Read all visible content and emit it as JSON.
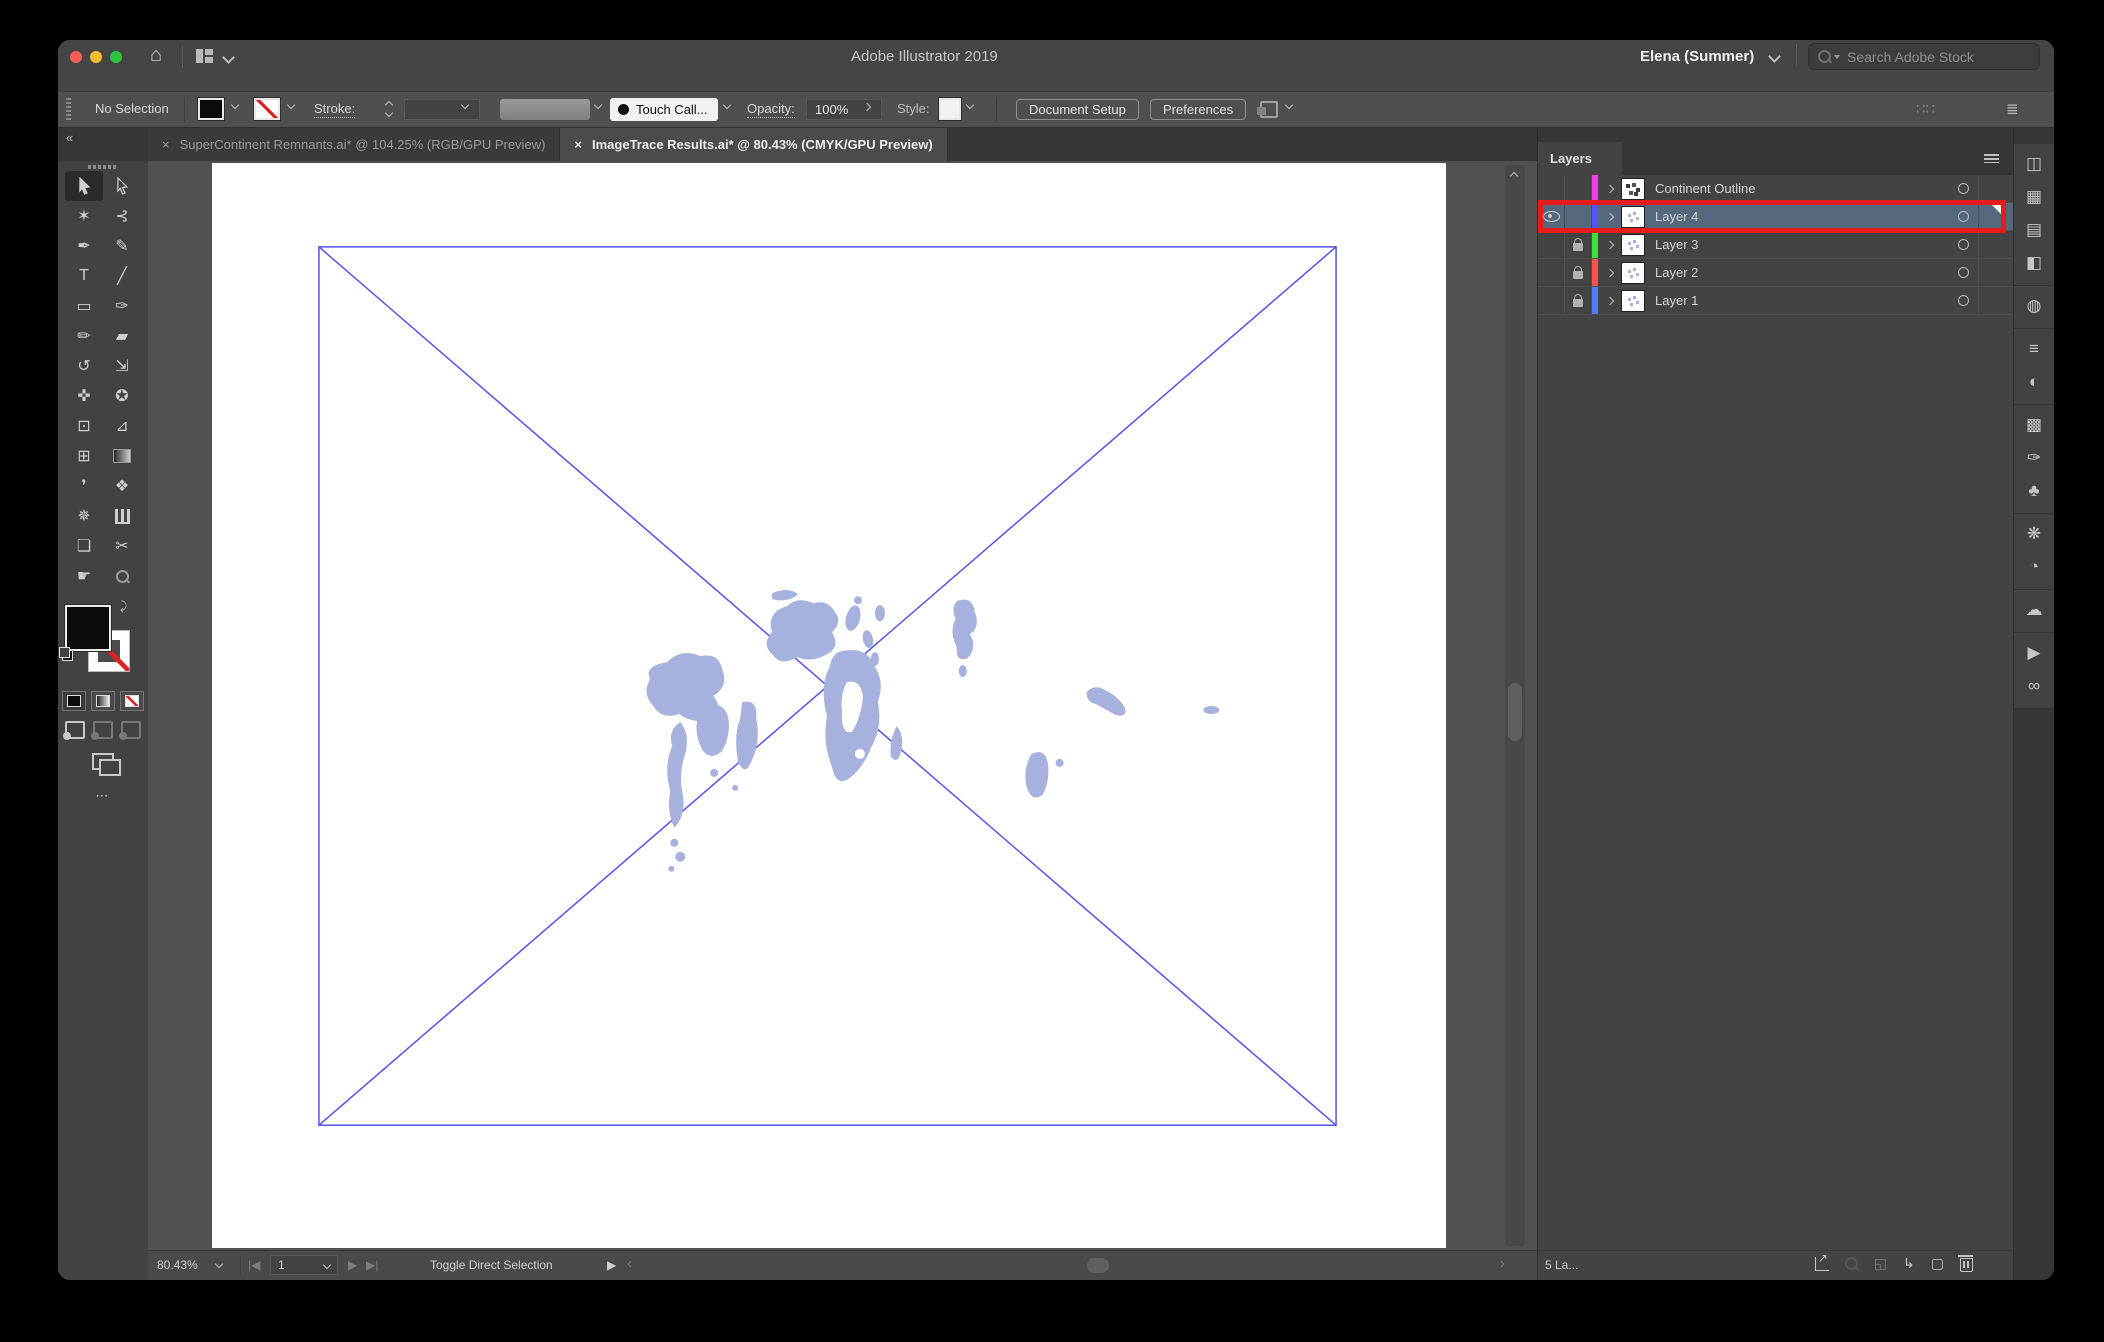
{
  "colors": {
    "titlebar": "#454545",
    "controlbar": "#4f4f4f",
    "tabbar": "#363636",
    "pasteboard": "#515151",
    "annotation_red": "#e81b1b",
    "selected_row": "#54677c",
    "map_fill": "#a7b1dd",
    "frame_line": "#5353ea",
    "traffic_close": "#f95e57",
    "traffic_min": "#fcbb2f",
    "traffic_zoom": "#29c73f"
  },
  "titlebar": {
    "title": "Adobe Illustrator 2019",
    "user": "Elena (Summer)",
    "search_placeholder": "Search Adobe Stock",
    "home_glyph": "⌂"
  },
  "controlbar": {
    "no_selection": "No Selection",
    "stroke_label": "Stroke:",
    "brush_profile": "Touch Call...",
    "opacity_label": "Opacity:",
    "opacity_value": "100%",
    "style_label": "Style:",
    "document_setup": "Document Setup",
    "preferences": "Preferences",
    "dots_glyph": "∷∷",
    "menu_glyph": "≣"
  },
  "tabs": [
    {
      "close": "×",
      "label": "SuperContinent Remnants.ai* @ 104.25% (RGB/GPU Preview)",
      "active": false
    },
    {
      "close": "×",
      "label": "ImageTrace Results.ai* @ 80.43% (CMYK/GPU Preview)",
      "active": true
    }
  ],
  "tooldock": {
    "collapse": "«",
    "ellipsis": "⋯",
    "tools": [
      {
        "name": "selection-tool",
        "kind": "cursor",
        "selected": true
      },
      {
        "name": "direct-selection-tool",
        "kind": "cursor-o"
      },
      {
        "name": "magic-wand-tool",
        "glyph": "✶"
      },
      {
        "name": "lasso-tool",
        "glyph": "⊰"
      },
      {
        "name": "pen-tool",
        "glyph": "✒"
      },
      {
        "name": "curvature-tool",
        "glyph": "✎"
      },
      {
        "name": "type-tool",
        "glyph": "T"
      },
      {
        "name": "line-tool",
        "glyph": "╱"
      },
      {
        "name": "rectangle-tool",
        "glyph": "▭"
      },
      {
        "name": "paintbrush-tool",
        "glyph": "✑"
      },
      {
        "name": "pencil-tool",
        "glyph": "✏"
      },
      {
        "name": "eraser-tool",
        "glyph": "▰"
      },
      {
        "name": "rotate-tool",
        "glyph": "↺"
      },
      {
        "name": "scale-tool",
        "glyph": "⇲"
      },
      {
        "name": "width-tool",
        "glyph": "✜"
      },
      {
        "name": "puppet-warp-tool",
        "glyph": "✪"
      },
      {
        "name": "free-transform-tool",
        "glyph": "⊡"
      },
      {
        "name": "perspective-grid-tool",
        "glyph": "⊿"
      },
      {
        "name": "mesh-tool",
        "glyph": "⊞"
      },
      {
        "name": "gradient-tool",
        "kind": "grad"
      },
      {
        "name": "eyedropper-tool",
        "glyph": "❜"
      },
      {
        "name": "blend-tool",
        "glyph": "❖"
      },
      {
        "name": "symbol-sprayer-tool",
        "glyph": "✵"
      },
      {
        "name": "graph-tool",
        "kind": "bars"
      },
      {
        "name": "artboard-tool",
        "glyph": "❏"
      },
      {
        "name": "slice-tool",
        "glyph": "✂"
      },
      {
        "name": "hand-tool",
        "glyph": "☛"
      },
      {
        "name": "zoom-tool",
        "kind": "mag"
      }
    ]
  },
  "layers_panel": {
    "title": "Layers",
    "count_text": "5 La...",
    "rows": [
      {
        "name": "Continent Outline",
        "color": "#f23cf2",
        "eye": false,
        "lock": false,
        "selected": false,
        "annotated": false,
        "thumb": "sketch"
      },
      {
        "name": "Layer 4",
        "color": "#5454ff",
        "eye": true,
        "lock": false,
        "selected": true,
        "annotated": true,
        "thumb": "light"
      },
      {
        "name": "Layer 3",
        "color": "#32e632",
        "eye": false,
        "lock": true,
        "selected": false,
        "annotated": false,
        "thumb": "light"
      },
      {
        "name": "Layer 2",
        "color": "#ff5050",
        "eye": false,
        "lock": true,
        "selected": false,
        "annotated": false,
        "thumb": "light"
      },
      {
        "name": "Layer 1",
        "color": "#4f7cff",
        "eye": false,
        "lock": true,
        "selected": false,
        "annotated": false,
        "thumb": "light"
      }
    ],
    "footer_icons": [
      {
        "name": "collect-for-export-icon",
        "kind": "boxarrow",
        "dim": false
      },
      {
        "name": "locate-object-icon",
        "kind": "mag",
        "dim": true
      },
      {
        "name": "make-clipping-mask-icon",
        "glyph": "◱",
        "dim": true
      },
      {
        "name": "new-sublayer-icon",
        "glyph": "↳",
        "dim": false
      },
      {
        "name": "new-layer-icon",
        "glyph": "▢",
        "dim": false
      },
      {
        "name": "delete-layer-icon",
        "kind": "trash",
        "dim": false
      }
    ]
  },
  "right_strip": {
    "groups": [
      [
        {
          "name": "libraries-icon",
          "glyph": "◫"
        },
        {
          "name": "artboards-icon",
          "glyph": "▦"
        },
        {
          "name": "align-icon",
          "glyph": "▤"
        },
        {
          "name": "pathfinder-icon",
          "glyph": "◧"
        }
      ],
      [
        {
          "name": "shape-builder-icon",
          "glyph": "◍"
        }
      ],
      [
        {
          "name": "stroke-icon",
          "glyph": "≡"
        },
        {
          "name": "transparency-icon",
          "glyph": "◐"
        }
      ],
      [
        {
          "name": "swatches-icon",
          "glyph": "▩"
        },
        {
          "name": "brushes-icon",
          "glyph": "✑"
        },
        {
          "name": "symbols-icon",
          "glyph": "♣"
        }
      ],
      [
        {
          "name": "color-icon",
          "glyph": "❋"
        },
        {
          "name": "color-guide-icon",
          "glyph": "◔"
        }
      ],
      [
        {
          "name": "creative-cloud-icon",
          "glyph": "☁"
        }
      ],
      [
        {
          "name": "actions-icon",
          "glyph": "▶"
        },
        {
          "name": "links-icon",
          "glyph": "∞"
        }
      ]
    ]
  },
  "statusbar": {
    "zoom": "80.43%",
    "page": "1",
    "status_text": "Toggle Direct Selection",
    "nav_first": "|◀",
    "nav_prev": "◀",
    "nav_next": "▶",
    "nav_last": "▶|",
    "play": "▶",
    "back": "‹",
    "fwd": "›"
  }
}
